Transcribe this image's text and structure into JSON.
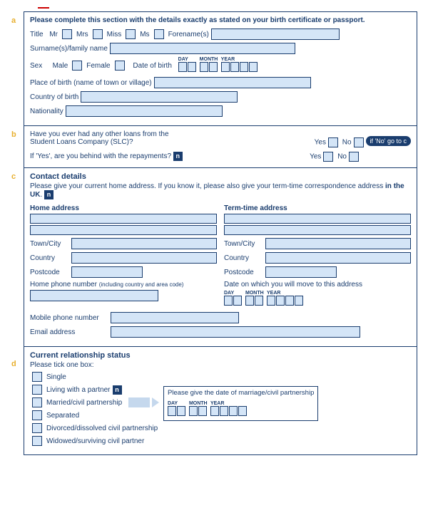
{
  "markers": {
    "a": "a",
    "b": "b",
    "c": "c",
    "d": "d"
  },
  "a": {
    "instruct": "Please complete this section with the details exactly as stated on your birth certificate or passport.",
    "title": "Title",
    "mr": "Mr",
    "mrs": "Mrs",
    "miss": "Miss",
    "ms": "Ms",
    "forenames": "Forename(s)",
    "surname": "Surname(s)/family name",
    "sex": "Sex",
    "male": "Male",
    "female": "Female",
    "dob": "Date of birth",
    "day": "DAY",
    "month": "MONTH",
    "year": "YEAR",
    "pob": "Place of birth (name of town or village)",
    "cob": "Country of birth",
    "nat": "Nationality"
  },
  "b": {
    "q1a": "Have you ever had any other loans from the",
    "q1b": "Student Loans Company (SLC)?",
    "yes": "Yes",
    "no": "No",
    "goto": "if 'No' go to c",
    "q2": "If 'Yes', are you behind with the repayments?"
  },
  "c": {
    "heading": "Contact details",
    "intro1": "Please give your current home address. If you know it, please also give your term-time correspondence address ",
    "intro2": "in the UK",
    "home": "Home address",
    "term": "Term-time address",
    "town": "Town/City",
    "country": "Country",
    "postcode": "Postcode",
    "homephone": "Home phone number",
    "homephone2": "(including country and area code)",
    "movedate": "Date on which you will move to this address",
    "day": "DAY",
    "month": "MONTH",
    "year": "YEAR",
    "mobile": "Mobile phone number",
    "email": "Email address"
  },
  "d": {
    "heading": "Current relationship status",
    "tick": "Please tick one box:",
    "single": "Single",
    "living": "Living with a partner",
    "married": "Married/civil partnership",
    "separated": "Separated",
    "divorced": "Divorced/dissolved civil partnership",
    "widowed": "Widowed/surviving civil partner",
    "givedate": "Please give the date of marriage/civil partnership",
    "day": "DAY",
    "month": "MONTH",
    "year": "YEAR"
  },
  "n": "n"
}
